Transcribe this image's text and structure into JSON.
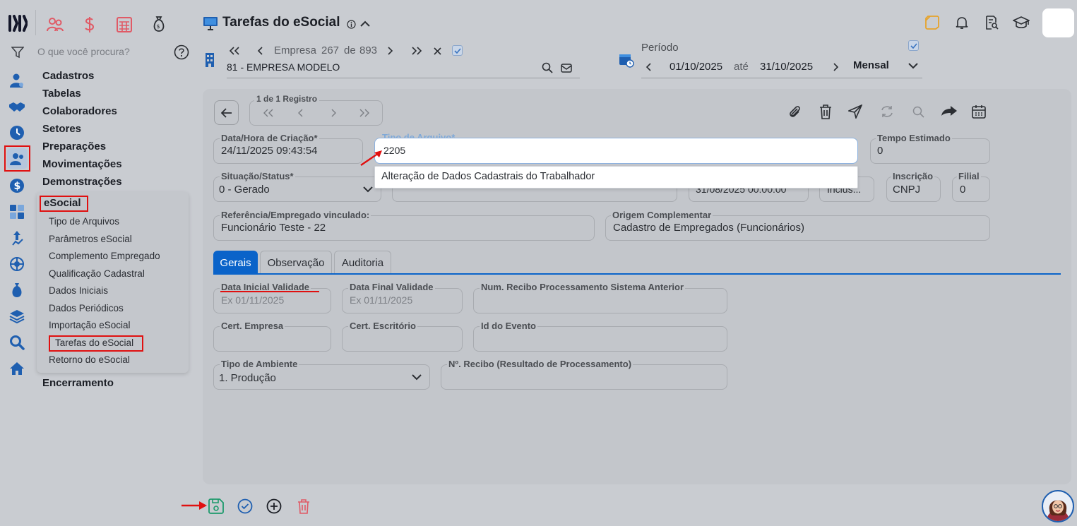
{
  "sidebar": {
    "search_placeholder": "O que você procura?",
    "menu": [
      "Cadastros",
      "Tabelas",
      "Colaboradores",
      "Setores",
      "Preparações",
      "Movimentações",
      "Demonstrações"
    ],
    "submenu_title": "eSocial",
    "submenu_items": [
      "Tipo de Arquivos",
      "Parâmetros eSocial",
      "Complemento Empregado",
      "Qualificação Cadastral",
      "Dados Iniciais",
      "Dados Periódicos",
      "Importação eSocial",
      "Tarefas do eSocial",
      "Retorno do eSocial"
    ],
    "after_menu": "Encerramento"
  },
  "header": {
    "title": "Tarefas do eSocial",
    "empresa_label": "Empresa",
    "empresa_current": "267",
    "empresa_of": "de",
    "empresa_total": "893",
    "empresa_name": "81 - EMPRESA MODELO",
    "periodo_label": "Período",
    "periodo_start": "01/10/2025",
    "periodo_ate": "até",
    "periodo_end": "31/10/2025",
    "periodo_type": "Mensal"
  },
  "form": {
    "record_label": "1 de 1 Registro",
    "data_hora": {
      "label": "Data/Hora de Criação*",
      "value": "24/11/2025 09:43:54"
    },
    "tipo_arquivo": {
      "label": "Tipo de Arquivo*",
      "value": "2205",
      "suggestion": "Alteração de Dados Cadastrais do Trabalhador"
    },
    "tempo_estimado": {
      "label": "Tempo Estimado",
      "value": "0"
    },
    "situacao": {
      "label": "Situação/Status*",
      "value": "0 - Gerado"
    },
    "data_hidden": "31/08/2025 00:00:00",
    "inclusao_hidden": "Inclus...",
    "inscricao": {
      "label": "Inscrição",
      "value": "CNPJ"
    },
    "filial": {
      "label": "Filial",
      "value": "0"
    },
    "referencia": {
      "label": "Referência/Empregado vinculado:",
      "value": "Funcionário Teste - 22"
    },
    "origem": {
      "label": "Origem Complementar",
      "value": "Cadastro de Empregados (Funcionários)"
    },
    "tabs": [
      "Gerais",
      "Observação",
      "Auditoria"
    ],
    "data_inicial": {
      "label": "Data Inicial Validade",
      "placeholder": "Ex 01/11/2025"
    },
    "data_final": {
      "label": "Data Final Validade",
      "placeholder": "Ex 01/11/2025"
    },
    "num_recibo": {
      "label": "Num. Recibo Processamento Sistema Anterior",
      "value": ""
    },
    "cert_empresa": {
      "label": "Cert. Empresa",
      "value": ""
    },
    "cert_escritorio": {
      "label": "Cert. Escritório",
      "value": ""
    },
    "id_evento": {
      "label": "Id do Evento",
      "value": ""
    },
    "tipo_ambiente": {
      "label": "Tipo de Ambiente",
      "value": "1. Produção"
    },
    "n_recibo": {
      "label": "Nº. Recibo (Resultado de Processamento)",
      "value": ""
    }
  },
  "colors": {
    "accent": "#0a63c9",
    "highlight": "#e01010",
    "save": "#1d9a6c"
  }
}
